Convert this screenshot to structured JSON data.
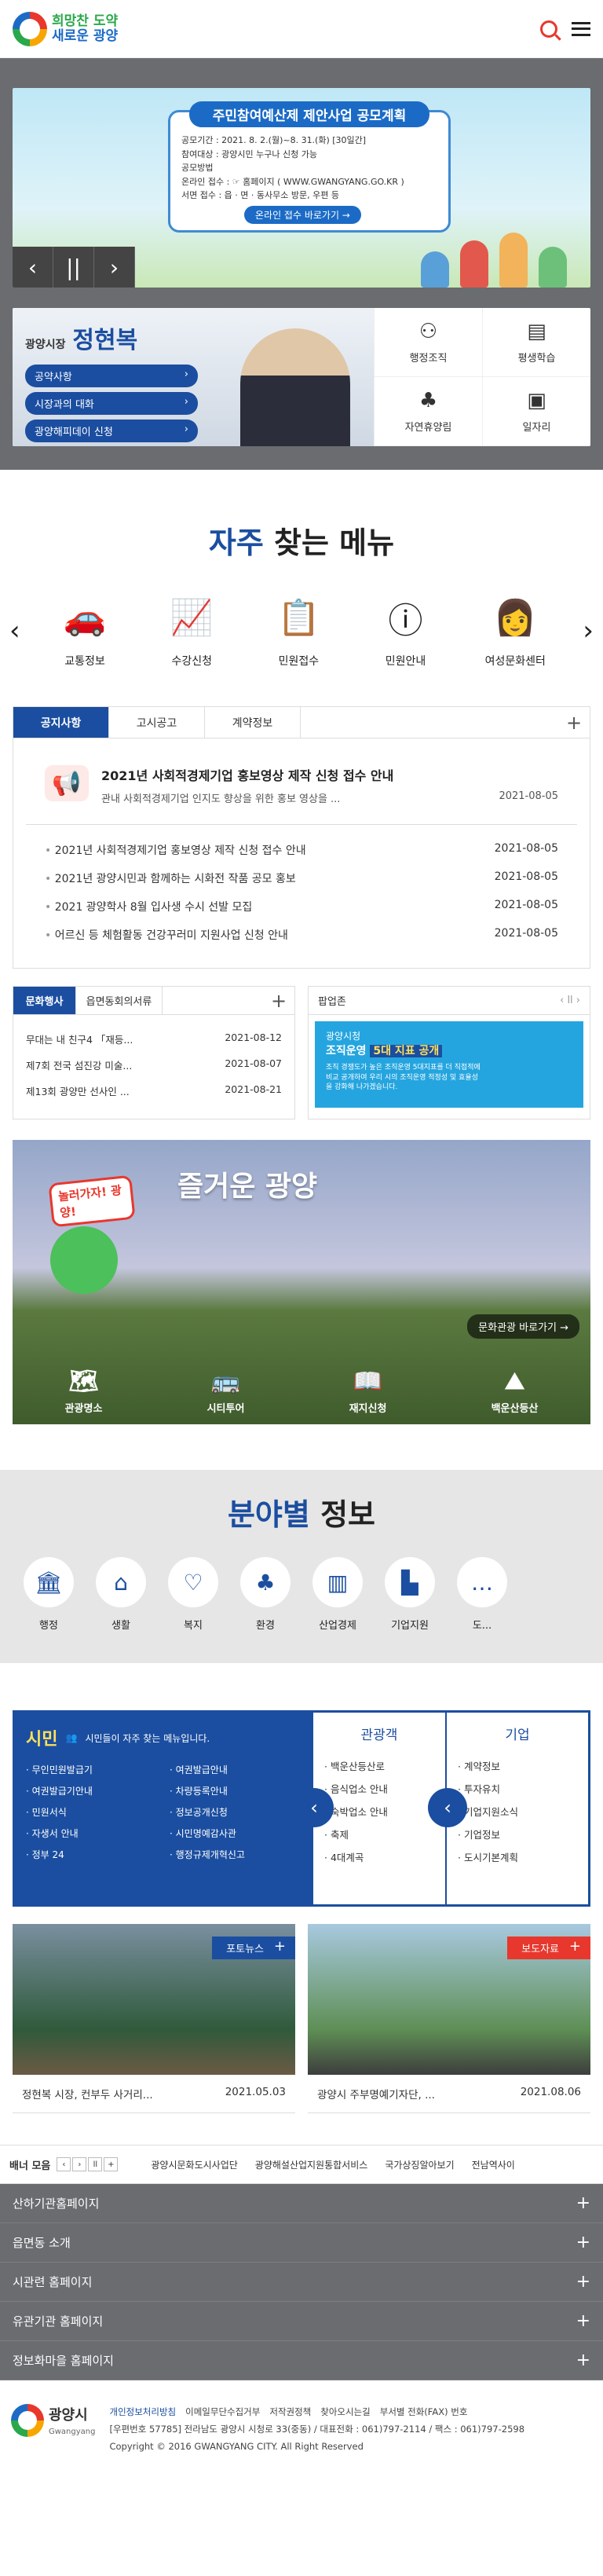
{
  "header": {
    "logo_line1": "희망찬 도약",
    "logo_line2": "새로운 광양"
  },
  "hero": {
    "card_title": "주민참여예산제 제안사업 공모계획",
    "lines": [
      "공모기간 : 2021. 8. 2.(월)~8. 31.(화) [30일간]",
      "참여대상 : 광양시민 누구나 신청 가능",
      "공모방법",
      "온라인 접수 : ☞ 홈페이지 ( WWW.GWANGYANG.GO.KR )",
      "서면 접수 : 읍 · 면 · 동사무소 방문, 우편 등"
    ],
    "card_btn": "온라인 접수 바로가기 →"
  },
  "mayor": {
    "title": "광양시장",
    "name": "정현복",
    "buttons": [
      "공약사항",
      "시장과의 대화",
      "광양해피데이 신청"
    ],
    "cells": [
      "행정조직",
      "평생학습",
      "자연휴양림",
      "일자리"
    ]
  },
  "quick": {
    "title_hl": "자주",
    "title_rest": "찾는 메뉴",
    "items": [
      "교통정보",
      "수강신청",
      "민원접수",
      "민원안내",
      "여성문화센터"
    ]
  },
  "notice": {
    "tabs": [
      "공지사항",
      "고시공고",
      "계약정보"
    ],
    "top_title": "2021년 사회적경제기업 홍보영상 제작 신청 접수 안내",
    "top_desc": "관내 사회적경제기업 인지도 향상을 위한 홍보 영상을 ...",
    "top_date": "2021-08-05",
    "list": [
      {
        "t": "2021년 사회적경제기업 홍보영상 제작 신청 접수 안내",
        "d": "2021-08-05"
      },
      {
        "t": "2021년 광양시민과 함께하는 시화전 작품 공모 홍보",
        "d": "2021-08-05"
      },
      {
        "t": "2021 광양학사 8월 입사생 수시 선발 모집",
        "d": "2021-08-05"
      },
      {
        "t": "어르신 등 체험활동 건강꾸러미 지원사업 신청 안내",
        "d": "2021-08-05"
      }
    ]
  },
  "culture": {
    "tabs": [
      "문화행사",
      "읍면동회의서류"
    ],
    "list": [
      {
        "t": "무대는 내 친구4 「재등...",
        "d": "2021-08-12"
      },
      {
        "t": "제7회 전국 섬진강 미술...",
        "d": "2021-08-07"
      },
      {
        "t": "제13회 광양만 선사인 ...",
        "d": "2021-08-21"
      }
    ]
  },
  "popup": {
    "title": "팝업존",
    "head1": "광양시청",
    "head2": "조직운영 ",
    "head2_hl": "5대 지표 공개",
    "body": "조직 경쟁도가 높은 조직운영 5대지표를 더 직접적에 비교 공개하여 우리 시의 조직운영 적정성 및 효율성을 강화해 나가겠습니다.",
    "controls": "‹ ll ›"
  },
  "tour": {
    "title": "즐거운 광양",
    "sign": "놀러가자! 광양!",
    "link": "문화관광 바로가기 →",
    "items": [
      "관광명소",
      "시티투어",
      "재지신청",
      "백운산등산"
    ]
  },
  "field": {
    "title_hl": "분야별",
    "title_rest": "정보",
    "items": [
      "행정",
      "생활",
      "복지",
      "환경",
      "산업경제",
      "기업지원",
      "도..."
    ]
  },
  "citizen": {
    "label": "시민",
    "desc": "시민들이 자주 찾는 메뉴입니다.",
    "items": [
      "무인민원발급기",
      "여권발급안내",
      "여권발급기안내",
      "차량등록안내",
      "민원서식",
      "정보공개신청",
      "자생서 안내",
      "시민명예감사관",
      "정부 24",
      "행정규제개혁신고"
    ],
    "tourist_title": "관광객",
    "tourist_items": [
      "백운산등산로",
      "음식업소 안내",
      "숙박업소 안내",
      "축제",
      "4대계곡"
    ],
    "biz_title": "기업",
    "biz_items": [
      "계약정보",
      "투자유치",
      "기업지원소식",
      "기업정보",
      "도시기본계획"
    ]
  },
  "photos": [
    {
      "tag": "포토뉴스",
      "cap": "정현복 시장, 컨부두 사거리...",
      "date": "2021.05.03"
    },
    {
      "tag": "보도자료",
      "cap": "광양시 주부명예기자단, ...",
      "date": "2021.08.06"
    }
  ],
  "banner_bar": {
    "label": "배너 모음",
    "links": [
      "광양시문화도시사업단",
      "광양해설산업지원통합서비스",
      "국가상징알아보기",
      "전남역사이"
    ]
  },
  "accordion": [
    "산하기관홈페이지",
    "읍면동 소개",
    "시관련 홈페이지",
    "유관기관 홈페이지",
    "정보화마을 홈페이지"
  ],
  "footer": {
    "name": "광양시",
    "name_en": "Gwangyang",
    "links": [
      "개인정보처리방침",
      "이메일무단수집거부",
      "저작권정책",
      "찾아오시는길",
      "부서별 전화(FAX) 번호"
    ],
    "address": "[우편번호 57785] 전라남도 광양시 시청로 33(중동) / 대표전화 : 061)797-2114 / 팩스 : 061)797-2598",
    "copyright": "Copyright © 2016 GWANGYANG CITY. All Right Reserved"
  },
  "colors": {
    "accent": "#1b4ea0",
    "red": "#e8372c"
  }
}
